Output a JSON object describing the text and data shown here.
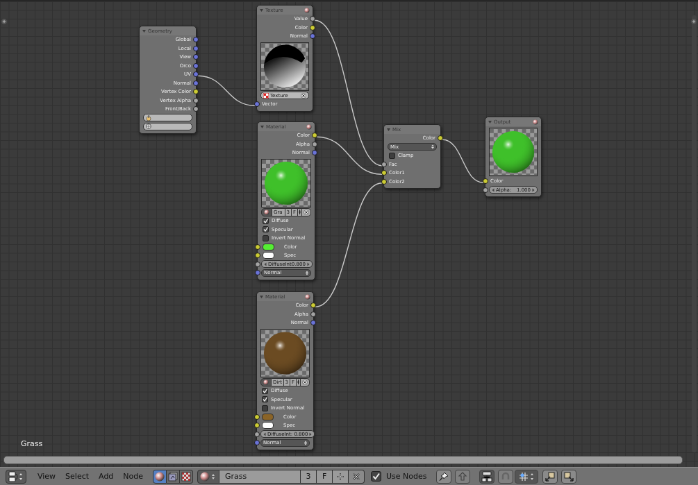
{
  "nodes": [
    {
      "title": "Geometry",
      "preview_toggle": false,
      "rows": [
        {
          "kind": "output",
          "label": "Global",
          "color": "#6a73d8"
        },
        {
          "kind": "output",
          "label": "Local",
          "color": "#6a73d8"
        },
        {
          "kind": "output",
          "label": "View",
          "color": "#6a73d8"
        },
        {
          "kind": "output",
          "label": "Orco",
          "color": "#6a73d8"
        },
        {
          "kind": "output",
          "label": "UV",
          "color": "#6a73d8"
        },
        {
          "kind": "output",
          "label": "Normal",
          "color": "#6a73d8"
        },
        {
          "kind": "output",
          "label": "Vertex Color",
          "color": "#cccc33"
        },
        {
          "kind": "output",
          "label": "Vertex Alpha",
          "color": "#a3a3a3"
        },
        {
          "kind": "output",
          "label": "Front/Back",
          "color": "#a3a3a3"
        },
        {
          "kind": "icon_field"
        },
        {
          "kind": "icon_field"
        }
      ]
    },
    {
      "title": "Texture",
      "preview_toggle": true,
      "rows": [
        {
          "kind": "output",
          "label": "Value",
          "color": "#a3a3a3"
        },
        {
          "kind": "output",
          "label": "Color",
          "color": "#cccc33"
        },
        {
          "kind": "output",
          "label": "Normal",
          "color": "#6a73d8"
        },
        {
          "kind": "texture_preview"
        },
        {
          "kind": "datablock",
          "label": "Texture"
        },
        {
          "kind": "input",
          "label": "Vector",
          "color": "#6a73d8"
        }
      ]
    },
    {
      "title": "Material",
      "preview_toggle": true,
      "rows": [
        {
          "kind": "output",
          "label": "Color",
          "color": "#cccc33"
        },
        {
          "kind": "output",
          "label": "Alpha",
          "color": "#a3a3a3"
        },
        {
          "kind": "output",
          "label": "Normal",
          "color": "#6a73d8"
        },
        {
          "kind": "material_preview",
          "color": "#3fc02a"
        },
        {
          "kind": "material_block",
          "name": "Gra",
          "users": "3",
          "fake_user": "F"
        },
        {
          "kind": "checkbox",
          "label": "Diffuse",
          "checked": true
        },
        {
          "kind": "checkbox",
          "label": "Specular",
          "checked": true
        },
        {
          "kind": "checkbox",
          "label": "Invert Normal",
          "checked": false
        },
        {
          "kind": "color_input",
          "label": "Color",
          "color": "#cccc33",
          "swatch": {
            "color": "#55ee33"
          }
        },
        {
          "kind": "color_input",
          "label": "Spec",
          "color": "#cccc33",
          "swatch": {
            "color": "#ffffff"
          }
        },
        {
          "kind": "number",
          "text": "DiffuseInt0.800",
          "color": "#a3a3a3"
        },
        {
          "kind": "dropdown",
          "value": "Normal",
          "color": "#6a73d8"
        }
      ]
    },
    {
      "title": "Material",
      "preview_toggle": true,
      "rows": [
        {
          "kind": "output",
          "label": "Color",
          "color": "#cccc33"
        },
        {
          "kind": "output",
          "label": "Alpha",
          "color": "#a3a3a3"
        },
        {
          "kind": "output",
          "label": "Normal",
          "color": "#6a73d8"
        },
        {
          "kind": "material_preview",
          "color": "#6b4b22"
        },
        {
          "kind": "material_block",
          "name": "Dirt",
          "users": "3",
          "fake_user": "F"
        },
        {
          "kind": "checkbox",
          "label": "Diffuse",
          "checked": true
        },
        {
          "kind": "checkbox",
          "label": "Specular",
          "checked": true
        },
        {
          "kind": "checkbox",
          "label": "Invert Normal",
          "checked": false
        },
        {
          "kind": "color_input",
          "label": "Color",
          "color": "#cccc33",
          "swatch": {
            "color": "#8a6428"
          }
        },
        {
          "kind": "color_input",
          "label": "Spec",
          "color": "#cccc33",
          "swatch": {
            "color": "#ffffff"
          }
        },
        {
          "kind": "number",
          "text": "DiffuseInt: 0.800",
          "color": "#a3a3a3"
        },
        {
          "kind": "dropdown",
          "value": "Normal",
          "color": "#6a73d8"
        }
      ]
    },
    {
      "title": "Mix",
      "preview_toggle": false,
      "rows": [
        {
          "kind": "output",
          "label": "Color",
          "color": "#cccc33"
        },
        {
          "kind": "dropdown",
          "value": "Mix"
        },
        {
          "kind": "checkbox",
          "label": "Clamp",
          "checked": false
        },
        {
          "kind": "input",
          "label": "Fac",
          "color": "#a3a3a3"
        },
        {
          "kind": "input",
          "label": "Color1",
          "color": "#cccc33"
        },
        {
          "kind": "input",
          "label": "Color2",
          "color": "#cccc33"
        }
      ]
    },
    {
      "title": "Output",
      "preview_toggle": true,
      "rows": [
        {
          "kind": "material_preview",
          "color": "#3fc02a"
        },
        {
          "kind": "input",
          "label": "Color",
          "color": "#cccc33"
        },
        {
          "kind": "number",
          "label": "Alpha:",
          "value": "1.000",
          "color": "#a3a3a3"
        }
      ]
    }
  ],
  "canvas_label": "Grass",
  "toolbar": {
    "menus": [
      "View",
      "Select",
      "Add",
      "Node"
    ],
    "tree_types": [
      {
        "kind": "shader",
        "selected": true
      },
      {
        "kind": "texture",
        "selected": false
      },
      {
        "kind": "compositing",
        "selected": false
      }
    ],
    "material": {
      "name": "Grass",
      "users": "3",
      "fake_user": "F"
    },
    "use_nodes": {
      "label": "Use Nodes",
      "checked": true
    }
  }
}
